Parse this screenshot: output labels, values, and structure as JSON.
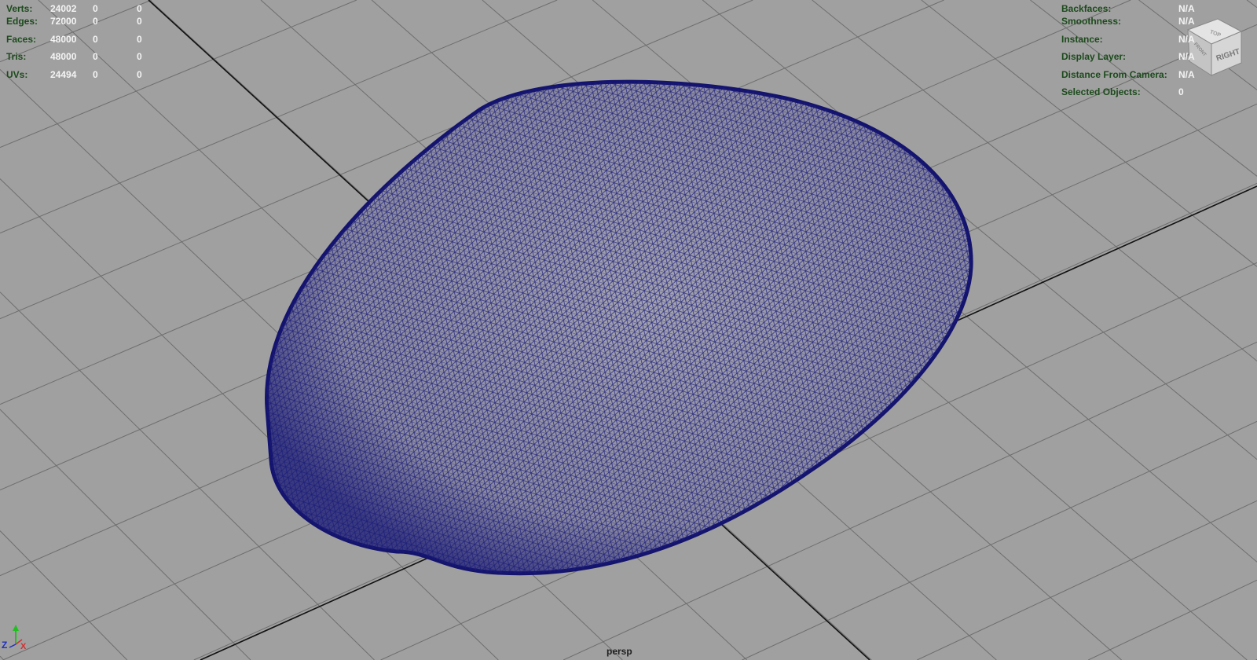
{
  "viewport": {
    "camera_name": "persp"
  },
  "poly_count": {
    "rows": [
      {
        "label": "Verts:",
        "values": [
          "24002",
          "0",
          "0"
        ]
      },
      {
        "label": "Edges:",
        "values": [
          "72000",
          "0",
          "0"
        ]
      },
      {
        "label": "Faces:",
        "values": [
          "48000",
          "0",
          "0"
        ]
      },
      {
        "label": "Tris:",
        "values": [
          "48000",
          "0",
          "0"
        ]
      },
      {
        "label": "UVs:",
        "values": [
          "24494",
          "0",
          "0"
        ]
      }
    ]
  },
  "object_details": {
    "rows": [
      {
        "label": "Backfaces:",
        "value": "N/A"
      },
      {
        "label": "Smoothness:",
        "value": "N/A"
      },
      {
        "label": "Instance:",
        "value": "N/A"
      },
      {
        "label": "Display Layer:",
        "value": "N/A"
      },
      {
        "label": "Distance From Camera:",
        "value": "N/A"
      },
      {
        "label": "Selected Objects:",
        "value": "0"
      }
    ]
  },
  "view_cube": {
    "top_label": "TOP",
    "right_label": "RIGHT",
    "front_label": "FRONT"
  },
  "axis_gizmo": {
    "x": "X",
    "y": "Y",
    "z": "Z"
  },
  "colors": {
    "mesh_wire": "#1a1a7a",
    "label": "#1c4a1c",
    "value": "#f4f4f4",
    "background": "#a0a0a0"
  }
}
